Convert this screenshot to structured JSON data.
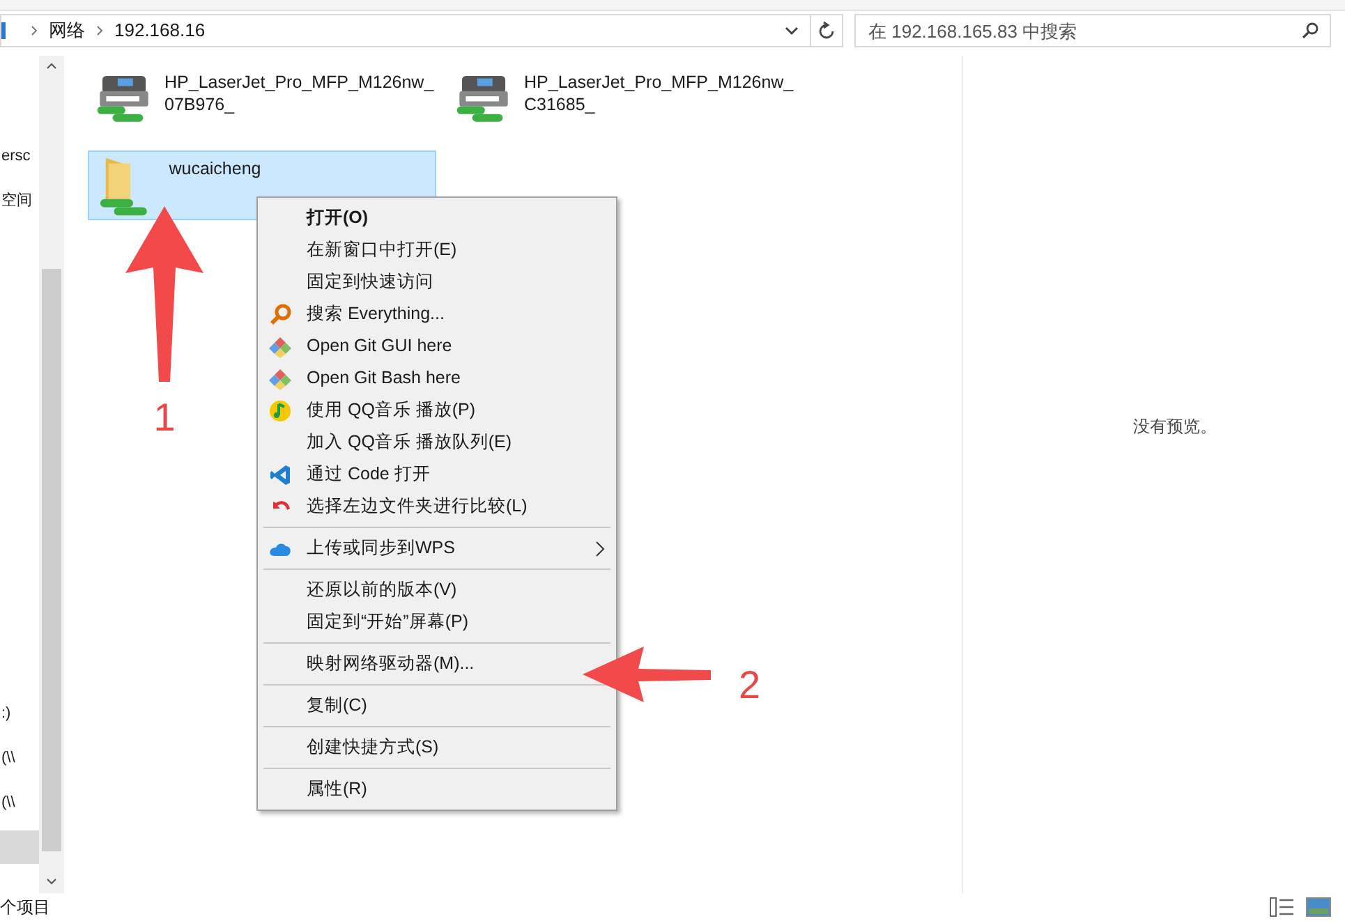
{
  "address_bar": {
    "segments": [
      "网络",
      "192.168.16"
    ]
  },
  "search": {
    "placeholder": "在 192.168.165.83 中搜索"
  },
  "nav_pane": {
    "items": [
      {
        "label": "ersc",
        "selected": false
      },
      {
        "label": "空间",
        "selected": false
      },
      {
        "label": ":)",
        "selected": false
      },
      {
        "label": "(\\\\",
        "selected": false
      },
      {
        "label": "(\\\\",
        "selected": false
      },
      {
        "selected": true
      }
    ]
  },
  "items": [
    {
      "kind": "printer",
      "name": "HP_LaserJet_Pro_MFP_M126nw_ 07B976_",
      "selected": false
    },
    {
      "kind": "printer",
      "name": "HP_LaserJet_Pro_MFP_M126nw_ C31685_",
      "selected": false
    },
    {
      "kind": "share",
      "name": "wucaicheng",
      "selected": true
    }
  ],
  "context_menu": {
    "groups": [
      [
        {
          "label": "打开(O)",
          "bold": true
        },
        {
          "label": "在新窗口中打开(E)"
        },
        {
          "label": "固定到快速访问"
        },
        {
          "label": "搜索 Everything...",
          "kind": "search"
        },
        {
          "label": "Open Git GUI here",
          "kind": "git"
        },
        {
          "label": "Open Git Bash here",
          "kind": "git"
        },
        {
          "label": "使用 QQ音乐 播放(P)",
          "kind": "music"
        },
        {
          "label": "加入 QQ音乐 播放队列(E)"
        },
        {
          "label": "通过 Code 打开",
          "kind": "code"
        },
        {
          "label": "选择左边文件夹进行比较(L)",
          "kind": "undo"
        }
      ],
      [
        {
          "label": "上传或同步到WPS",
          "kind": "cloud",
          "submenu": true
        }
      ],
      [
        {
          "label": "还原以前的版本(V)"
        },
        {
          "label": "固定到“开始”屏幕(P)"
        }
      ],
      [
        {
          "label": "映射网络驱动器(M)..."
        }
      ],
      [
        {
          "label": "复制(C)"
        }
      ],
      [
        {
          "label": "创建快捷方式(S)"
        }
      ],
      [
        {
          "label": "属性(R)"
        }
      ]
    ]
  },
  "preview": {
    "message": "没有预览。"
  },
  "annotations": [
    {
      "kind": "up",
      "label": "1"
    },
    {
      "kind": "left",
      "label": "2"
    }
  ],
  "status_bar": {
    "text": "个项目"
  }
}
